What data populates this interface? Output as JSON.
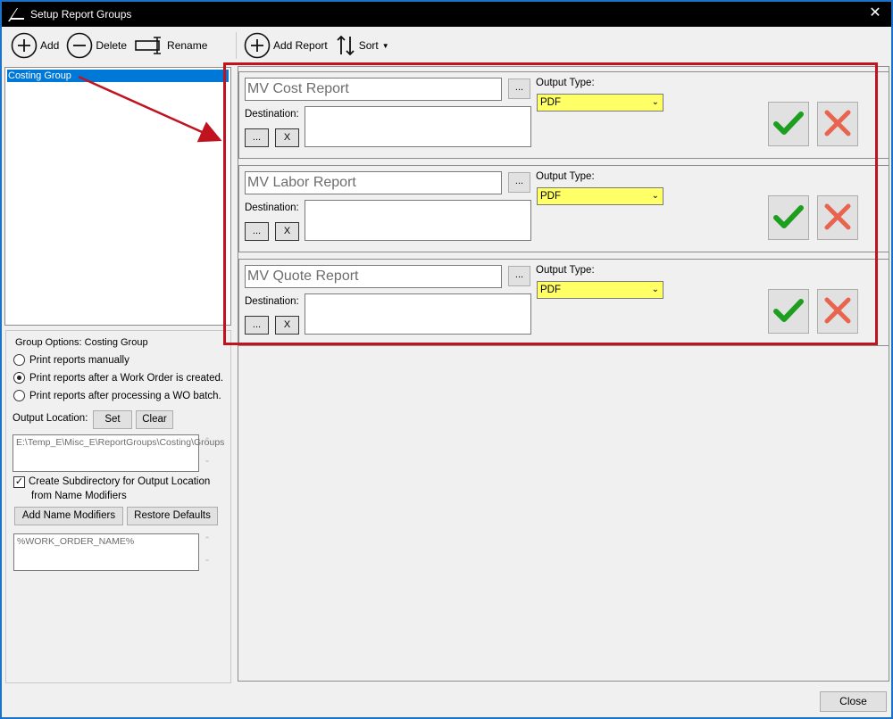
{
  "window": {
    "title": "Setup Report Groups",
    "close_glyph": "✕"
  },
  "left_toolbar": {
    "add": "Add",
    "delete": "Delete",
    "rename": "Rename"
  },
  "right_toolbar": {
    "add_report": "Add Report",
    "sort": "Sort"
  },
  "groups": {
    "items": [
      {
        "label": "Costing Group"
      }
    ]
  },
  "group_options": {
    "title": "Group Options: Costing Group",
    "radio_manual": "Print reports manually",
    "radio_after_wo": "Print reports after a Work Order is created.",
    "radio_after_batch": "Print reports after processing a WO batch.",
    "selected_radio": "after_wo",
    "output_location_label": "Output Location:",
    "set_button": "Set",
    "clear_button": "Clear",
    "output_path": "E:\\Temp_E\\Misc_E\\ReportGroups\\Costing\\Groups",
    "subdir_checkbox_label_1": "Create Subdirectory for Output Location",
    "subdir_checkbox_label_2": "from Name Modifiers",
    "subdir_checked": true,
    "add_name_modifiers": "Add Name Modifiers",
    "restore_defaults": "Restore Defaults",
    "name_modifier_value": "%WORK_ORDER_NAME%"
  },
  "reports": [
    {
      "name": "MV Cost Report",
      "output_type_label": "Output Type:",
      "output_type": "PDF",
      "destination_label": "Destination:",
      "browse": "...",
      "dest_browse": "...",
      "dest_clear": "X"
    },
    {
      "name": "MV Labor Report",
      "output_type_label": "Output Type:",
      "output_type": "PDF",
      "destination_label": "Destination:",
      "browse": "...",
      "dest_browse": "...",
      "dest_clear": "X"
    },
    {
      "name": "MV Quote Report",
      "output_type_label": "Output Type:",
      "output_type": "PDF",
      "destination_label": "Destination:",
      "browse": "...",
      "dest_browse": "...",
      "dest_clear": "X"
    }
  ],
  "footer": {
    "close": "Close"
  },
  "colors": {
    "selection": "#0078d7",
    "output_type_bg": "#ffff66",
    "ok_green": "#1e9e1e",
    "cancel_red": "#e8644f",
    "annotation": "#c1121f"
  }
}
